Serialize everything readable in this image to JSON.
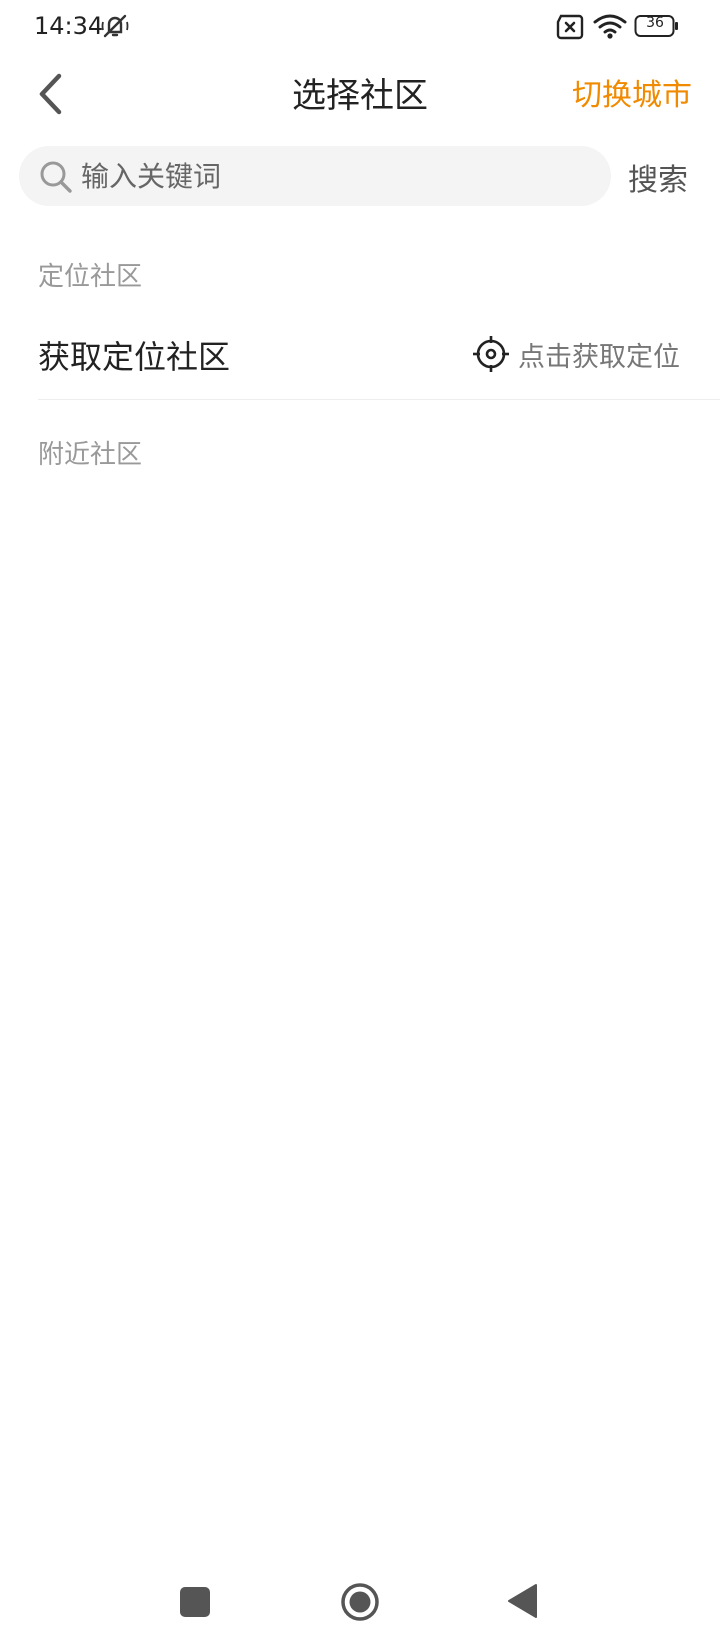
{
  "status_bar": {
    "time": "14:34",
    "battery": "36",
    "icons": [
      "mute-icon",
      "sim-error-icon",
      "wifi-icon",
      "battery-icon"
    ]
  },
  "nav": {
    "back_icon": "chevron-left-icon",
    "title": "选择社区",
    "switch_city": "切换城市"
  },
  "search": {
    "icon": "search-icon",
    "placeholder": "输入关键词",
    "value": "",
    "button": "搜索"
  },
  "location_section": {
    "label": "定位社区",
    "item_title": "获取定位社区",
    "action_icon": "locate-target-icon",
    "action_text": "点击获取定位"
  },
  "nearby_section": {
    "label": "附近社区",
    "items": []
  },
  "system_nav": {
    "buttons": [
      "recent-apps-button",
      "home-button",
      "back-button"
    ]
  },
  "colors": {
    "accent": "#f08a00",
    "search_bg": "#f4f4f4",
    "section_label": "#999999",
    "divider": "#eeeeee"
  }
}
